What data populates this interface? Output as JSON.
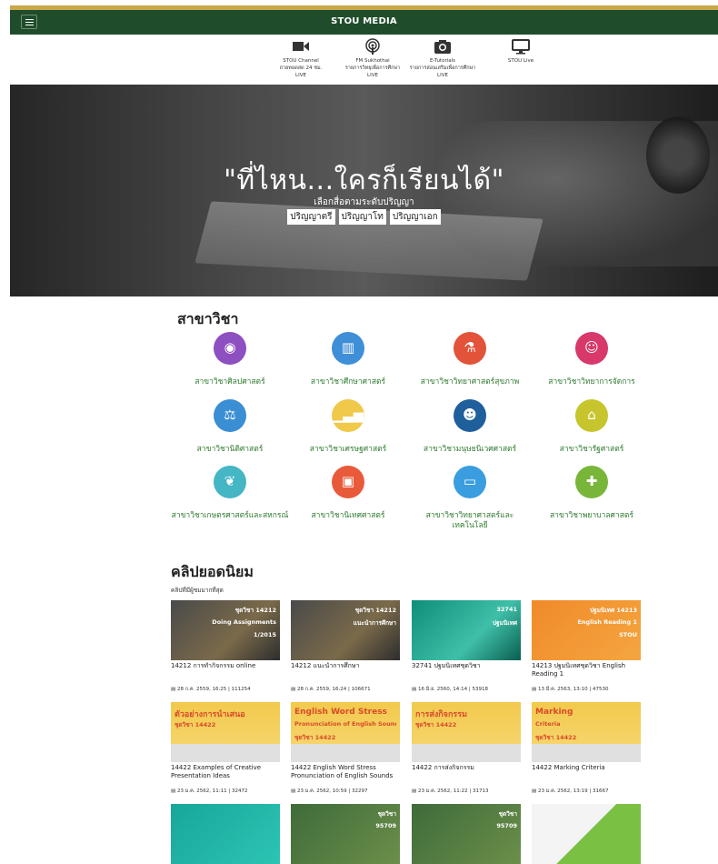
{
  "header": {
    "title": "STOU MEDIA"
  },
  "media_nav": [
    {
      "icon": "video-camera-icon",
      "lines": [
        "STOU Channel",
        "ถ่ายทอดสด 24 ชม.",
        "LIVE"
      ]
    },
    {
      "icon": "radio-broadcast-icon",
      "lines": [
        "FM Sukhothai",
        "รายการวิทยุเพื่อการศึกษา",
        "LIVE"
      ]
    },
    {
      "icon": "camera-icon",
      "lines": [
        "E-Tutorials",
        "รายการสอนเสริมเพื่อการศึกษา",
        "LIVE"
      ]
    },
    {
      "icon": "monitor-icon",
      "lines": [
        "STOU Live"
      ]
    }
  ],
  "hero": {
    "title": "\"ที่ไหน...ใครก็เรียนได้\"",
    "subtitle": "เลือกสื่อตามระดับปริญญา",
    "links": [
      "ปริญญาตรี",
      "ปริญญาโท",
      "ปริญญาเอก"
    ]
  },
  "departments": {
    "heading": "สาขาวิชา",
    "items": [
      {
        "label": "สาขาวิชาศิลปศาสตร์",
        "color": "#8e4fc1",
        "icon": "eye-icon",
        "glyph": "◉"
      },
      {
        "label": "สาขาวิชาศึกษาศาสตร์",
        "color": "#3e8fd8",
        "icon": "books-icon",
        "glyph": "▥"
      },
      {
        "label": "สาขาวิชาวิทยาศาสตร์สุขภาพ",
        "color": "#e2533a",
        "icon": "flask-icon",
        "glyph": "⚗"
      },
      {
        "label": "สาขาวิชาวิทยาการจัดการ",
        "color": "#d8386a",
        "icon": "people-icon",
        "glyph": "☺"
      },
      {
        "label": "สาขาวิชานิติศาสตร์",
        "color": "#3a8ed4",
        "icon": "scales-icon",
        "glyph": "⚖"
      },
      {
        "label": "สาขาวิชาเศรษฐศาสตร์",
        "color": "#f0c84a",
        "icon": "chart-icon",
        "glyph": "▁▃▅"
      },
      {
        "label": "สาขาวิชามนุษยนิเวศศาสตร์",
        "color": "#1f5f9c",
        "icon": "person-icon",
        "glyph": "☻"
      },
      {
        "label": "สาขาวิชารัฐศาสตร์",
        "color": "#c6c52e",
        "icon": "building-icon",
        "glyph": "⌂"
      },
      {
        "label": "สาขาวิชาเกษตรศาสตร์และสหกรณ์",
        "color": "#45b6c3",
        "icon": "leaf-icon",
        "glyph": "❦"
      },
      {
        "label": "สาขาวิชานิเทศศาสตร์",
        "color": "#e85a3a",
        "icon": "film-camera-icon",
        "glyph": "▣"
      },
      {
        "label": "สาขาวิชาวิทยาศาสตร์และเทคโนโลยี",
        "color": "#3a9de0",
        "icon": "computer-icon",
        "glyph": "▭"
      },
      {
        "label": "สาขาวิชาพยาบาลศาสตร์",
        "color": "#78b63a",
        "icon": "medical-cross-icon",
        "glyph": "✚"
      }
    ]
  },
  "clips": {
    "heading": "คลิปยอดนิยม",
    "subheading": "คลิปที่มีผู้ชมมากที่สุด",
    "items": [
      {
        "title": "14212 การทำกิจกรรม online",
        "meta": "28 ก.ค. 2559, 16:25 | 111254",
        "theme": "dark-doc",
        "thumb_text": [
          "ชุดวิชา 14212",
          "Doing Assignments",
          "1/2015"
        ]
      },
      {
        "title": "14212 แนะนำการศึกษา",
        "meta": "28 ก.ค. 2559, 16:24 | 106671",
        "theme": "dark-doc",
        "thumb_text": [
          "ชุดวิชา 14212",
          "แนะนำการศึกษา"
        ]
      },
      {
        "title": "32741 ปฐมนิเทศชุดวิชา",
        "meta": "16 มิ.ย. 2560, 14:14 | 53918",
        "theme": "teal",
        "thumb_text": [
          "32741",
          "ปฐมนิเทศ"
        ]
      },
      {
        "title": "14213 ปฐมนิเทศชุดวิชา English Reading 1",
        "meta": "13 มี.ค. 2563, 13:10 | 47530",
        "theme": "orange",
        "thumb_text": [
          "ปฐมนิเทศ 14213",
          "English Reading 1",
          "STOU"
        ]
      },
      {
        "title": "14422 Examples of Creative Presentation Ideas",
        "meta": "23 ม.ค. 2562, 11:11 | 32472",
        "theme": "yellow",
        "thumb_text": [
          "ตัวอย่างการนำเสนอ",
          "ชุดวิชา 14422"
        ]
      },
      {
        "title": "14422 English Word Stress Pronunciation of English Sounds",
        "meta": "23 ม.ค. 2562, 10:59 | 32297",
        "theme": "yellow",
        "thumb_text": [
          "English Word Stress",
          "Pronunciation of English Sounds",
          "ชุดวิชา 14422"
        ]
      },
      {
        "title": "14422 การส่งกิจกรรม",
        "meta": "23 ม.ค. 2562, 11:22 | 31713",
        "theme": "yellow",
        "thumb_text": [
          "การส่งกิจกรรม",
          "ชุดวิชา 14422"
        ]
      },
      {
        "title": "14422 Marking Criteria",
        "meta": "23 ม.ค. 2562, 13:19 | 31667",
        "theme": "yellow",
        "thumb_text": [
          "Marking",
          "Criteria",
          "ชุดวิชา 14422"
        ]
      },
      {
        "title": "",
        "meta": "",
        "theme": "teal2",
        "thumb_text": []
      },
      {
        "title": "",
        "meta": "",
        "theme": "green",
        "thumb_text": [
          "ชุดวิชา",
          "95709"
        ]
      },
      {
        "title": "",
        "meta": "",
        "theme": "green",
        "thumb_text": [
          "ชุดวิชา",
          "95709"
        ]
      },
      {
        "title": "",
        "meta": "",
        "theme": "white-green",
        "thumb_text": []
      }
    ]
  }
}
